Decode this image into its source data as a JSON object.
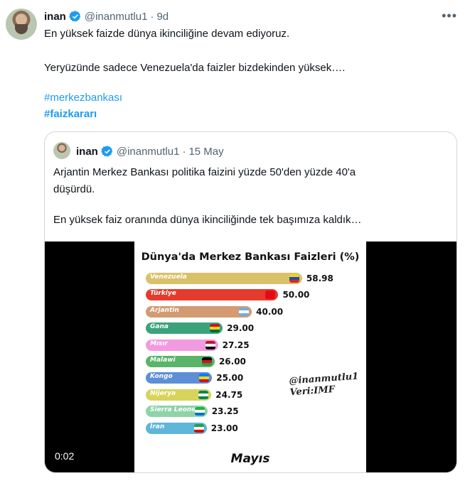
{
  "tweet": {
    "author_name": "inan",
    "author_handle": "@inanmutlu1",
    "separator": "·",
    "time": "9d",
    "lines": [
      "En yüksek faizde dünya ikinciliğine devam ediyoruz.",
      "Yeryüzünde sadece Venezuela'da faizler bizdekinden yüksek…."
    ],
    "hashtags": [
      "#merkezbankası",
      "#faizkararı"
    ],
    "icons": {
      "verified": "verified-badge-icon",
      "more": "more-options-icon"
    }
  },
  "quote": {
    "author_name": "inan",
    "author_handle": "@inanmutlu1",
    "separator": "·",
    "time": "15 May",
    "lines": [
      "Arjantin Merkez Bankası politika faizini yüzde 50'den yüzde 40'a",
      "düşürdü.",
      "En yüksek faiz oranında dünya ikinciliğinde tek başımıza kaldık…"
    ],
    "video": {
      "timestamp": "0:02"
    }
  },
  "chart_data": {
    "type": "bar",
    "title": "Dünya'da Merkez Bankası Faizleri (%)",
    "categories": [
      "Venezuela",
      "Türkiye",
      "Arjantin",
      "Gana",
      "Mısır",
      "Malawi",
      "Kongo",
      "Nijerya",
      "Sierra Leone",
      "İran"
    ],
    "values": [
      58.98,
      50.0,
      40.0,
      29.0,
      27.25,
      26.0,
      25.0,
      24.75,
      23.25,
      23.0
    ],
    "value_labels": [
      "58.98",
      "50.00",
      "40.00",
      "29.00",
      "27.25",
      "26.00",
      "25.00",
      "24.75",
      "23.25",
      "23.00"
    ],
    "colors": [
      "#d9c16a",
      "#e53b2c",
      "#d49a72",
      "#3aa37c",
      "#f29ae0",
      "#5ab56b",
      "#5c8fd6",
      "#d8d35a",
      "#8fd3a8",
      "#5fb6d9"
    ],
    "watermark": [
      "@inanmutlu1",
      "Veri:IMF"
    ],
    "footer": "Mayıs",
    "legend": "none"
  }
}
